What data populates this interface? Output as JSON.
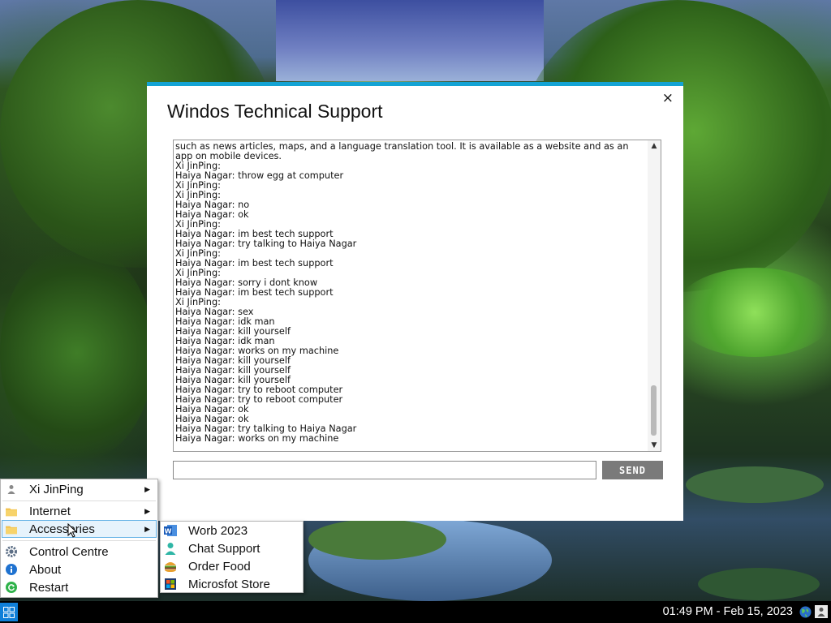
{
  "window": {
    "title": "Windos Technical Support",
    "close_label": "×",
    "chat_log": [
      "such as news articles, maps, and a language translation tool. It is available as a website and as an app on mobile devices.",
      "Xi JinPing:",
      "Haiya Nagar: throw egg at computer",
      "Xi JinPing:",
      "Xi JinPing:",
      "Haiya Nagar: no",
      "Haiya Nagar: ok",
      "Xi JinPing:",
      "Haiya Nagar: im best tech support",
      "Haiya Nagar: try talking to Haiya Nagar",
      "Xi JinPing:",
      "Haiya Nagar: im best tech support",
      "Xi JinPing:",
      "Haiya Nagar: sorry i dont know",
      "Haiya Nagar: im best tech support",
      "Xi JinPing:",
      "Haiya Nagar: sex",
      "Haiya Nagar: idk man",
      "Haiya Nagar: kill yourself",
      "Haiya Nagar: idk man",
      "Haiya Nagar: works on my machine",
      "Haiya Nagar: kill yourself",
      "Haiya Nagar: kill yourself",
      "Haiya Nagar: kill yourself",
      "Haiya Nagar: try to reboot computer",
      "Haiya Nagar: try to reboot computer",
      "Haiya Nagar: ok",
      "Haiya Nagar: ok",
      "Haiya Nagar: try talking to Haiya Nagar",
      "Haiya Nagar: works on my machine"
    ],
    "message_input": {
      "value": "",
      "placeholder": ""
    },
    "send_label": "SEND"
  },
  "start_menu": {
    "items": [
      {
        "label": "Xi JinPing",
        "icon": "user-icon",
        "has_submenu": true
      },
      {
        "label": "Internet",
        "icon": "folder-icon",
        "has_submenu": true
      },
      {
        "label": "Accessories",
        "icon": "folder-icon",
        "has_submenu": true,
        "highlighted": true
      },
      {
        "label": "Control Centre",
        "icon": "gear-icon",
        "has_submenu": false
      },
      {
        "label": "About",
        "icon": "info-icon",
        "has_submenu": false
      },
      {
        "label": "Restart",
        "icon": "restart-icon",
        "has_submenu": false
      }
    ],
    "submenu_arrow": "▶"
  },
  "accessories_submenu": {
    "items": [
      {
        "label": "Worb 2023",
        "icon": "word-icon"
      },
      {
        "label": "Chat Support",
        "icon": "person-icon"
      },
      {
        "label": "Order Food",
        "icon": "burger-icon"
      },
      {
        "label": "Microsfot Store",
        "icon": "store-icon"
      }
    ]
  },
  "taskbar": {
    "clock": "01:49 PM - Feb 15, 2023",
    "tray_icons": [
      "globe-icon",
      "user-icon"
    ]
  },
  "colors": {
    "window_accent": "#13a3d4",
    "send_button": "#7a7a7a",
    "menu_highlight": "#e6f3fc",
    "start_button": "#0f7fd8",
    "taskbar": "#000000"
  }
}
